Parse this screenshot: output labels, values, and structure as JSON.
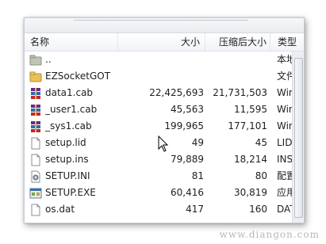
{
  "columns": {
    "name": "名称",
    "size": "大小",
    "compressed": "压缩后大小",
    "type": "类型"
  },
  "files": [
    {
      "name": "..",
      "size": "",
      "compressed": "",
      "type": "本地磁盘",
      "icon": "folder-up-icon"
    },
    {
      "name": "EZSocketGOT",
      "size": "",
      "compressed": "",
      "type": "文件夹",
      "icon": "folder-icon"
    },
    {
      "name": "data1.cab",
      "size": "22,425,693",
      "compressed": "21,731,503",
      "type": "WinRAR",
      "icon": "winrar-archive-icon"
    },
    {
      "name": "_user1.cab",
      "size": "45,563",
      "compressed": "11,595",
      "type": "WinRAR",
      "icon": "winrar-archive-icon"
    },
    {
      "name": "_sys1.cab",
      "size": "199,965",
      "compressed": "177,101",
      "type": "WinRAR",
      "icon": "winrar-archive-icon"
    },
    {
      "name": "setup.lid",
      "size": "49",
      "compressed": "45",
      "type": "LID 文件",
      "icon": "file-icon"
    },
    {
      "name": "setup.ins",
      "size": "79,889",
      "compressed": "18,214",
      "type": "INS 文件",
      "icon": "file-icon"
    },
    {
      "name": "SETUP.INI",
      "size": "81",
      "compressed": "80",
      "type": "配置设置",
      "icon": "ini-settings-icon"
    },
    {
      "name": "SETUP.EXE",
      "size": "60,416",
      "compressed": "30,819",
      "type": "应用程序",
      "icon": "exe-app-icon"
    },
    {
      "name": "os.dat",
      "size": "417",
      "compressed": "160",
      "type": "DAT 文件",
      "icon": "file-icon"
    }
  ],
  "watermark": "www.diangon.com",
  "colors": {
    "winrar_purple": "#6b2a86",
    "winrar_red": "#c4262e",
    "folder_yellow": "#e8c15a"
  }
}
